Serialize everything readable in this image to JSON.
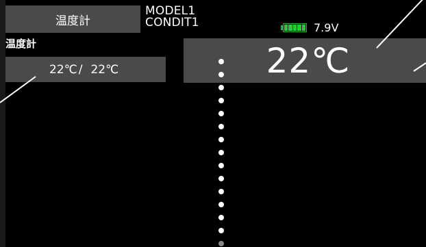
{
  "header": {
    "title_button_label": "温度計",
    "model_name": "MODEL1",
    "condition_name": "CONDIT1",
    "battery_voltage": "7.9V",
    "battery_level": 1.0,
    "battery_color": "#27c93a"
  },
  "sensor": {
    "label": "温度計",
    "current_value": "22℃",
    "separator": "/",
    "peak_value": "22℃"
  },
  "display": {
    "big_value": "22℃"
  },
  "colors": {
    "panel": "#4a4a4a",
    "background": "#000000"
  }
}
